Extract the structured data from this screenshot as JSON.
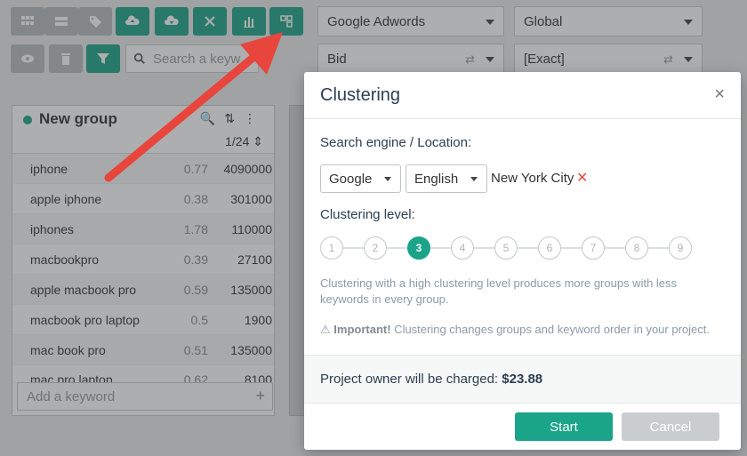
{
  "toolbar": {
    "engine_select": "Google Adwords",
    "region_select": "Global",
    "match_select": "Bid",
    "type_select": "[Exact]",
    "search_placeholder": "Search a keyw"
  },
  "group": {
    "title": "New group",
    "page": "1/24",
    "keywords": [
      {
        "name": "iphone",
        "competition": "0.77",
        "volume": "4090000"
      },
      {
        "name": "apple iphone",
        "competition": "0.38",
        "volume": "301000"
      },
      {
        "name": "iphones",
        "competition": "1.78",
        "volume": "110000"
      },
      {
        "name": "macbookpro",
        "competition": "0.39",
        "volume": "27100"
      },
      {
        "name": "apple macbook pro",
        "competition": "0.59",
        "volume": "135000"
      },
      {
        "name": "macbook pro laptop",
        "competition": "0.5",
        "volume": "1900"
      },
      {
        "name": "mac book pro",
        "competition": "0.51",
        "volume": "135000"
      },
      {
        "name": "mac pro laptop",
        "competition": "0.62",
        "volume": "8100"
      }
    ],
    "add_placeholder": "Add a keyword"
  },
  "modal": {
    "title": "Clustering",
    "close": "×",
    "engine_label": "Search engine / Location:",
    "engine": "Google",
    "language": "English",
    "location": "New York City",
    "remove": "✕",
    "level_label": "Clustering level:",
    "levels": [
      "1",
      "2",
      "3",
      "4",
      "5",
      "6",
      "7",
      "8",
      "9"
    ],
    "selected_level": 3,
    "description": "Clustering with a high clustering level produces more groups with less keywords in every group.",
    "important_label": "Important!",
    "important_text": " Clustering changes groups and keyword order in your project.",
    "charge_text": "Project owner will be charged: ",
    "charge_amount": "$23.88",
    "start": "Start",
    "cancel": "Cancel"
  },
  "colors": {
    "accent": "#1aa488",
    "remove": "#e74c3c",
    "arrow": "#e8453c"
  }
}
